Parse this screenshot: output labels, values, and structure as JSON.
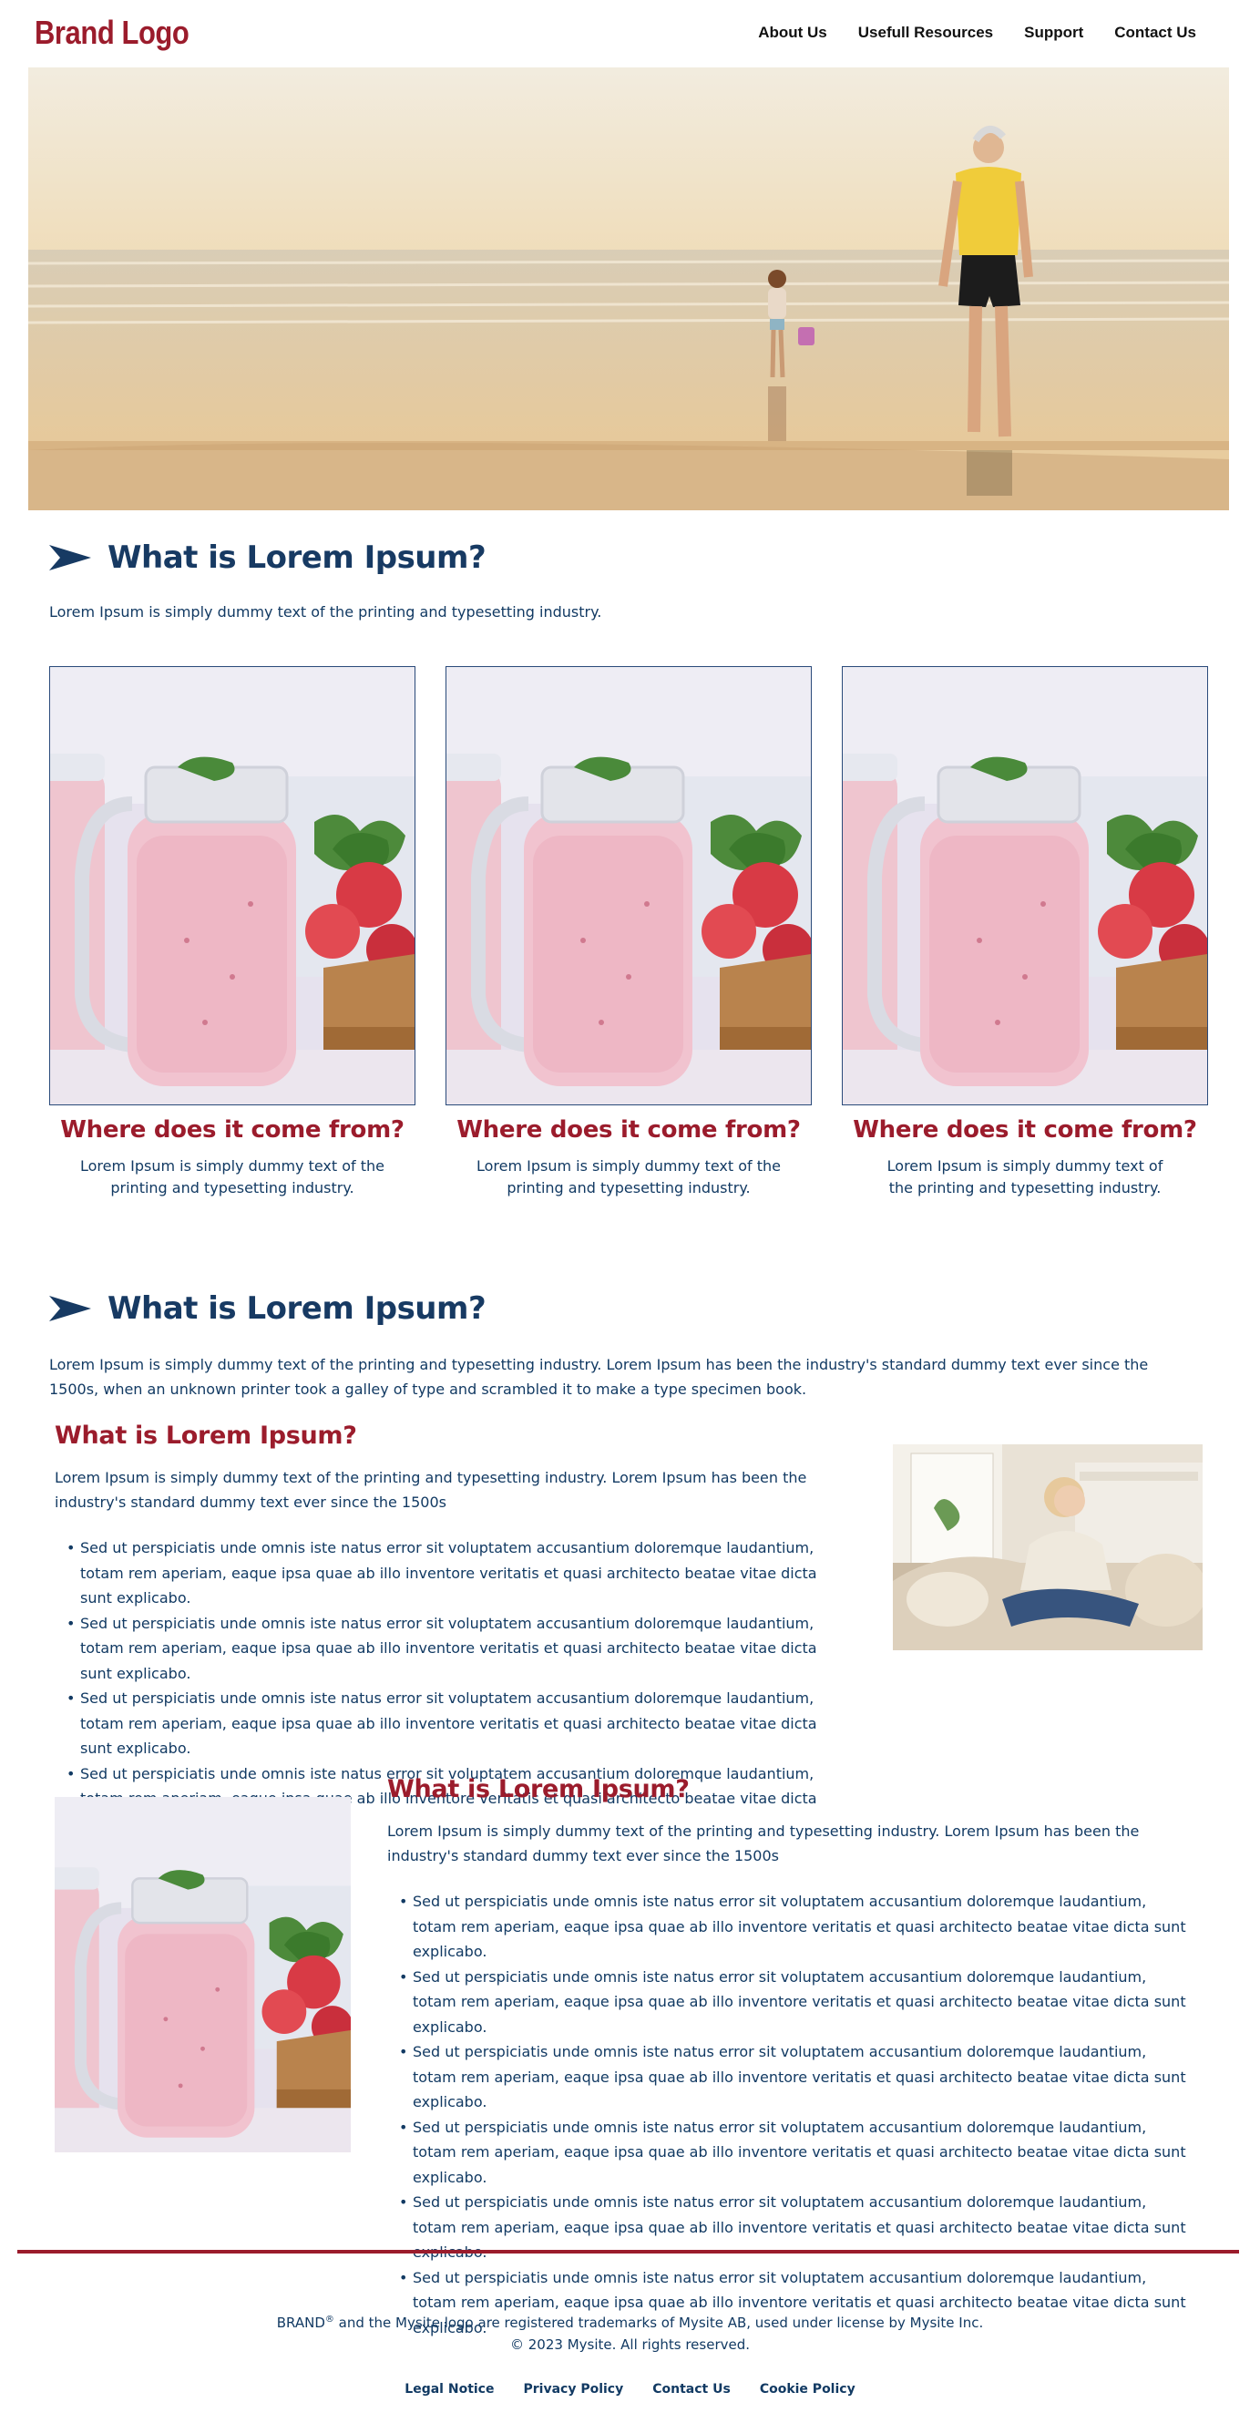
{
  "header": {
    "brand": "Brand Logo",
    "nav": [
      "About Us",
      "Usefull Resources",
      "Support",
      "Contact Us"
    ]
  },
  "section1": {
    "title": "What is Lorem Ipsum?",
    "intro": "Lorem Ipsum is simply dummy text of the printing and typesetting industry."
  },
  "cards": [
    {
      "title": "Where does it come from?",
      "text": "Lorem Ipsum is simply dummy text of the printing and typesetting industry."
    },
    {
      "title": "Where does it come from?",
      "text": "Lorem Ipsum is simply dummy text of the printing and typesetting industry."
    },
    {
      "title": "Where does it come from?",
      "text": "Lorem Ipsum is simply dummy text of the printing and typesetting industry."
    }
  ],
  "section2": {
    "title": "What is Lorem Ipsum?",
    "intro": "Lorem Ipsum is simply dummy text of the printing and typesetting industry. Lorem Ipsum has been the industry's standard dummy text ever since the 1500s, when an unknown printer took a galley of type and scrambled it to make a type specimen book."
  },
  "block1": {
    "title": "What is Lorem Ipsum?",
    "text": "Lorem Ipsum is simply dummy text of the printing and typesetting industry. Lorem Ipsum has been the industry's standard dummy text ever since the 1500s",
    "bullets": [
      "Sed ut perspiciatis unde omnis iste natus error sit voluptatem accusantium doloremque laudantium, totam rem aperiam, eaque ipsa quae ab illo inventore veritatis et quasi architecto beatae vitae dicta sunt explicabo.",
      "Sed ut perspiciatis unde omnis iste natus error sit voluptatem accusantium doloremque laudantium, totam rem aperiam, eaque ipsa quae ab illo inventore veritatis et quasi architecto beatae vitae dicta sunt explicabo.",
      "Sed ut perspiciatis unde omnis iste natus error sit voluptatem accusantium doloremque laudantium, totam rem aperiam, eaque ipsa quae ab illo inventore veritatis et quasi architecto beatae vitae dicta sunt explicabo.",
      "Sed ut perspiciatis unde omnis iste natus error sit voluptatem accusantium doloremque laudantium, totam rem aperiam, eaque ipsa quae ab illo inventore veritatis et quasi architecto beatae vitae dicta sunt explicabo."
    ]
  },
  "block2": {
    "title": "What is Lorem Ipsum?",
    "text": "Lorem Ipsum is simply dummy text of the printing and typesetting industry. Lorem Ipsum has been the industry's standard dummy text ever since the 1500s",
    "bullets": [
      "Sed ut perspiciatis unde omnis iste natus error sit voluptatem accusantium doloremque laudantium, totam rem aperiam, eaque ipsa quae ab illo inventore veritatis et quasi architecto beatae vitae dicta sunt explicabo.",
      "Sed ut perspiciatis unde omnis iste natus error sit voluptatem accusantium doloremque laudantium, totam rem aperiam, eaque ipsa quae ab illo inventore veritatis et quasi architecto beatae vitae dicta sunt explicabo.",
      "Sed ut perspiciatis unde omnis iste natus error sit voluptatem accusantium doloremque laudantium, totam rem aperiam, eaque ipsa quae ab illo inventore veritatis et quasi architecto beatae vitae dicta sunt explicabo.",
      "Sed ut perspiciatis unde omnis iste natus error sit voluptatem accusantium doloremque laudantium, totam rem aperiam, eaque ipsa quae ab illo inventore veritatis et quasi architecto beatae vitae dicta sunt explicabo.",
      "Sed ut perspiciatis unde omnis iste natus error sit voluptatem accusantium doloremque laudantium, totam rem aperiam, eaque ipsa quae ab illo inventore veritatis et quasi architecto beatae vitae dicta sunt explicabo.",
      "Sed ut perspiciatis unde omnis iste natus error sit voluptatem accusantium doloremque laudantium, totam rem aperiam, eaque ipsa quae ab illo inventore veritatis et quasi architecto beatae vitae dicta sunt explicabo."
    ]
  },
  "footer": {
    "trademark_pre": "BRAND",
    "trademark_sup": "®",
    "trademark_post": " and the Mysite logo are registered trademarks of Mysite AB, used under license by Mysite Inc.",
    "copyright": "© 2023 Mysite. All rights reserved.",
    "links": [
      "Legal Notice",
      "Privacy Policy",
      "Contact Us",
      "Cookie Policy"
    ]
  },
  "colors": {
    "brand": "#9b1c2c",
    "heading": "#173a63",
    "text": "#123a63"
  },
  "icons": {
    "section_bullet": "arrow-right-icon"
  }
}
